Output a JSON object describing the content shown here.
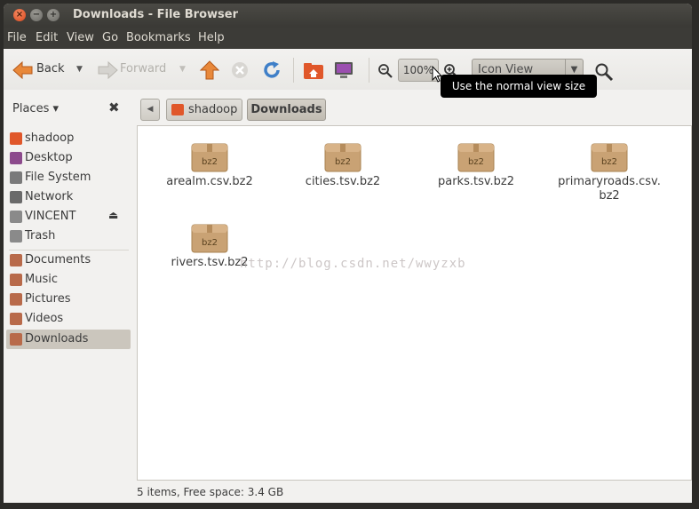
{
  "window": {
    "title": "Downloads - File Browser",
    "controls": {
      "close": "×",
      "minimize": "−",
      "maximize": "+"
    }
  },
  "menu": [
    "File",
    "Edit",
    "View",
    "Go",
    "Bookmarks",
    "Help"
  ],
  "toolbar": {
    "back_label": "Back",
    "forward_label": "Forward",
    "zoom_level": "100%",
    "view_mode": "Icon View",
    "dropdown_glyph": "▼"
  },
  "tooltip": "Use the normal view size",
  "sidebar": {
    "header": "Places",
    "header_arrow": "▾",
    "close_glyph": "✖",
    "eject_glyph": "⏏",
    "group1": [
      {
        "label": "shadoop",
        "icon": "home-icon",
        "color": "#e0572a"
      },
      {
        "label": "Desktop",
        "icon": "desktop-icon",
        "color": "#8c4a8c"
      },
      {
        "label": "File System",
        "icon": "drive-icon",
        "color": "#7a7a7a"
      },
      {
        "label": "Network",
        "icon": "network-icon",
        "color": "#6a6a6a"
      },
      {
        "label": "VINCENT",
        "icon": "usb-drive-icon",
        "color": "#8a8a8a"
      },
      {
        "label": "Trash",
        "icon": "trash-icon",
        "color": "#8a8a8a"
      }
    ],
    "group2": [
      {
        "label": "Documents",
        "icon": "documents-folder-icon",
        "color": "#b86a4a"
      },
      {
        "label": "Music",
        "icon": "music-folder-icon",
        "color": "#b86a4a"
      },
      {
        "label": "Pictures",
        "icon": "pictures-folder-icon",
        "color": "#b86a4a"
      },
      {
        "label": "Videos",
        "icon": "videos-folder-icon",
        "color": "#b86a4a"
      },
      {
        "label": "Downloads",
        "icon": "downloads-folder-icon",
        "color": "#b86a4a"
      }
    ],
    "selected": "Downloads"
  },
  "pathbar": {
    "left_arrow": "◀",
    "home": "shadoop",
    "current": "Downloads"
  },
  "files": [
    {
      "name": "arealm.csv.bz2",
      "badge": "bz2"
    },
    {
      "name": "cities.tsv.bz2",
      "badge": "bz2"
    },
    {
      "name": "parks.tsv.bz2",
      "badge": "bz2"
    },
    {
      "name": "primaryroads.csv.\nbz2",
      "badge": "bz2"
    },
    {
      "name": "rivers.tsv.bz2",
      "badge": "bz2"
    }
  ],
  "watermark": "http://blog.csdn.net/wwyzxb",
  "status": "5 items, Free space: 3.4 GB",
  "colors": {
    "accent": "#e0572a",
    "archive": "#c9a274",
    "selection": "#cbc6bd",
    "titlebar": "#3c3b37"
  }
}
